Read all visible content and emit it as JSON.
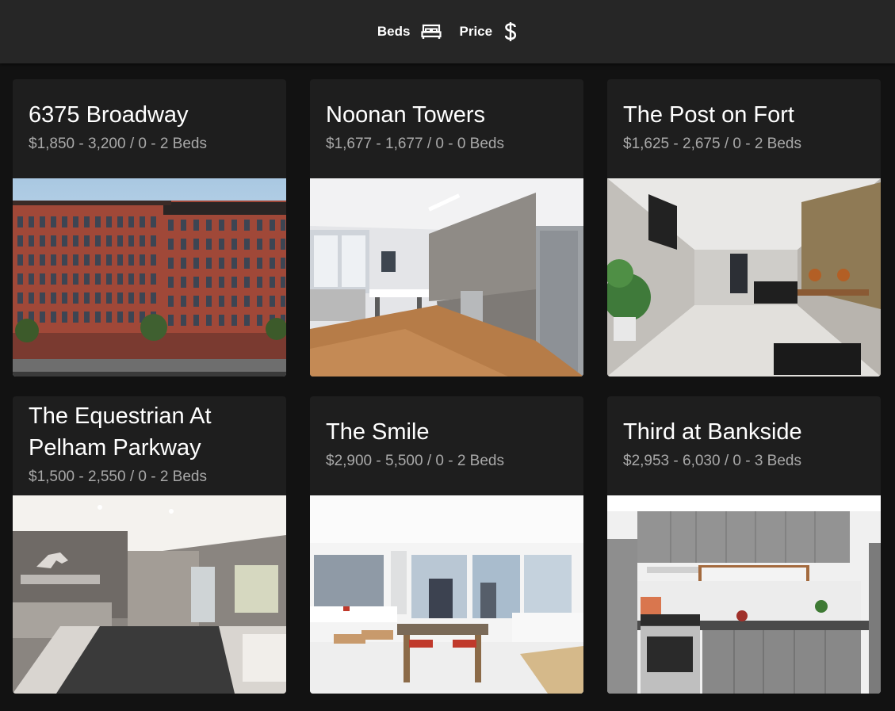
{
  "filters": [
    {
      "label": "Beds",
      "icon": "bed-icon"
    },
    {
      "label": "Price",
      "icon": "dollar-icon"
    }
  ],
  "listings": [
    {
      "name": "6375 Broadway",
      "summary": "$1,850 - 3,200 / 0 - 2 Beds",
      "photo": "brick-building-exterior"
    },
    {
      "name": "Noonan Towers",
      "summary": "$1,677 - 1,677 / 0 - 0 Beds",
      "photo": "kitchen-living-room"
    },
    {
      "name": "The Post on Fort",
      "summary": "$1,625 - 2,675 / 0 - 2 Beds",
      "photo": "lobby-hallway"
    },
    {
      "name": "The Equestrian At Pelham Parkway",
      "summary": "$1,500 - 2,550 / 0 - 2 Beds",
      "photo": "lobby-with-horse-logo"
    },
    {
      "name": "The Smile",
      "summary": "$2,900 - 5,500 / 0 - 2 Beds",
      "photo": "bright-apartment-city-view"
    },
    {
      "name": "Third at Bankside",
      "summary": "$2,953 - 6,030 / 0 - 3 Beds",
      "photo": "gray-kitchen"
    }
  ],
  "colors": {
    "background": "#121212",
    "topbar": "#262626",
    "card": "#1e1e1e",
    "title": "#ffffff",
    "subtitle": "#a9a9a9"
  }
}
